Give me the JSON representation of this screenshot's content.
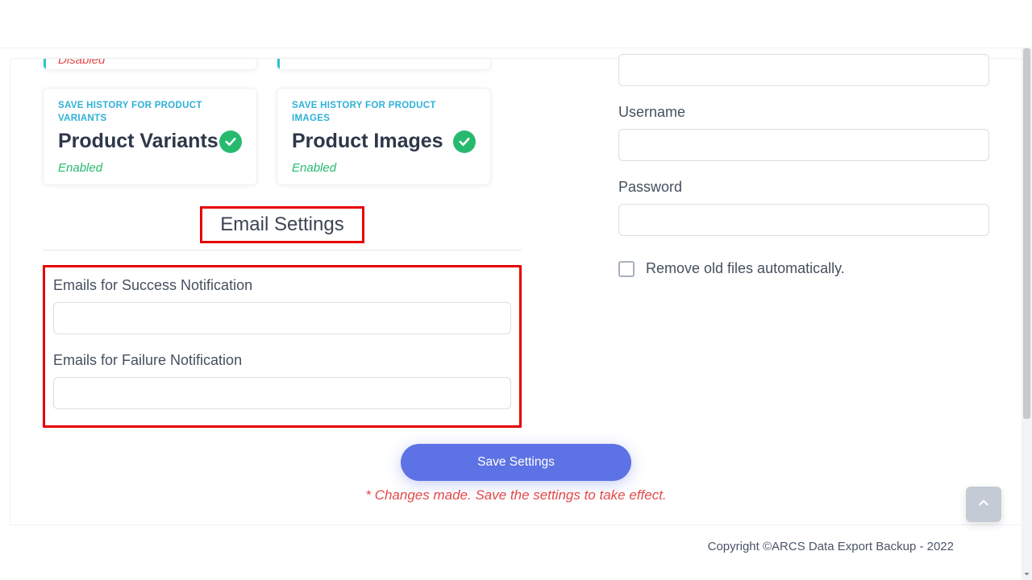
{
  "left": {
    "partial_card_status": "Disabled",
    "cards": [
      {
        "eyebrow": "SAVE HISTORY FOR PRODUCT VARIANTS",
        "title": "Product Variants",
        "status": "Enabled"
      },
      {
        "eyebrow": "SAVE HISTORY FOR PRODUCT IMAGES",
        "title": "Product Images",
        "status": "Enabled"
      }
    ],
    "section_heading": "Email Settings",
    "fields": {
      "success_label": "Emails for Success Notification",
      "success_value": "",
      "failure_label": "Emails for Failure Notification",
      "failure_value": ""
    }
  },
  "right": {
    "fields": {
      "host_value": "",
      "username_label": "Username",
      "username_value": "",
      "password_label": "Password",
      "password_value": "",
      "remove_old_label": "Remove old files automatically."
    }
  },
  "actions": {
    "save_label": "Save Settings",
    "notice": "* Changes made. Save the settings to take effect."
  },
  "footer": "Copyright ©ARCS Data Export Backup - 2022"
}
